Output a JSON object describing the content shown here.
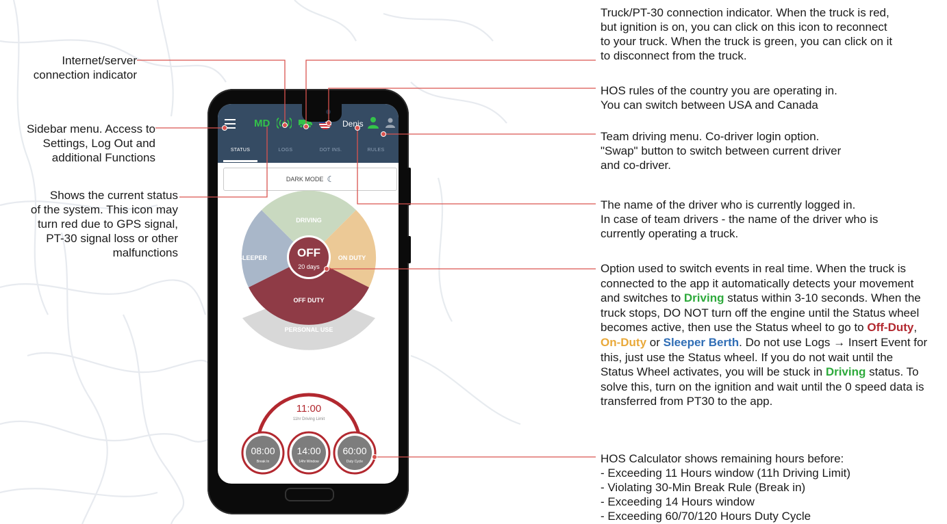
{
  "annotations": {
    "internet": [
      "Internet/server",
      "connection indicator"
    ],
    "sidebar": [
      "Sidebar menu. Access to",
      "Settings, Log Out and",
      "additional Functions"
    ],
    "status": [
      "Shows the current status",
      "of the system. This icon may",
      "turn red due to GPS signal,",
      "PT-30 signal loss or other",
      "malfunctions"
    ],
    "truck": [
      "Truck/PT-30 connection indicator. When the truck is red,",
      "but ignition is on, you can click on this icon to reconnect",
      "to your truck. When the truck is green, you can click on it",
      "to disconnect from the truck."
    ],
    "hos_rules": [
      "HOS rules of the country you are operating in.",
      "You can switch between USA and Canada"
    ],
    "team": [
      "Team driving menu. Co-driver login option.",
      "\"Swap\" button to switch between current driver",
      "and co-driver."
    ],
    "name": [
      "The name of the driver who is currently logged in.",
      "In case of team drivers - the name of the driver who is",
      "currently operating a truck."
    ],
    "wheel": {
      "p1": "Option used to switch events in real time. When the truck is connected to the app it automatically detects your movement and switches to ",
      "driving1": "Driving",
      "p2": " status within 3-10 seconds. When the truck stops, DO NOT turn off the engine until the Status wheel becomes active, then use the Status wheel to go to ",
      "offduty": "Off-Duty",
      "comma": ", ",
      "onduty": "On-Duty",
      "or": " or ",
      "sleeper": "Sleeper Berth",
      "p3": ". Do not use Logs → Insert Event for this, just use the Status wheel. If you do not wait until the Status Wheel activates, you will be stuck in ",
      "driving2": "Driving",
      "p4": " status. To solve this, turn on the ignition and wait until the 0 speed data is transferred from PT30 to the app."
    },
    "calculator": [
      "HOS Calculator shows remaining hours before:",
      "- Exceeding 11 Hours window (11h Driving Limit)",
      "- Violating 30-Min Break Rule (Break in)",
      "- Exceeding 14 Hours window",
      "- Exceeding 60/70/120 Hours Duty Cycle"
    ]
  },
  "app": {
    "status_badge": "MD",
    "driver_name": "Denis",
    "tabs": [
      "STATUS",
      "LOGS",
      "DOT INS.",
      "RULES"
    ],
    "dark_mode": "DARK MODE",
    "wheel": {
      "driving": "DRIVING",
      "sleeper": "SLEEPER",
      "on_duty": "ON DUTY",
      "off_duty": "OFF DUTY",
      "personal_use": "PERSONAL USE",
      "current_status": "OFF",
      "current_duration": "20 days"
    },
    "calculator": {
      "main_value": "11:00",
      "main_label": "11hr Driving Limit",
      "timers": [
        {
          "value": "08:00",
          "label": "Break In"
        },
        {
          "value": "14:00",
          "label": "14hr Window"
        },
        {
          "value": "60:00",
          "label": "Duty Cycle"
        }
      ]
    }
  },
  "colors": {
    "topbar": "#354b63",
    "accent_red": "#b2282f",
    "driving": "#c9d9c0",
    "sleeper": "#a9b7c9",
    "on_duty": "#ecc996",
    "off_duty": "#8f3b46",
    "personal_use": "#d7d7d7",
    "connected_green": "#34c24a",
    "connector_line": "#d9534f"
  }
}
